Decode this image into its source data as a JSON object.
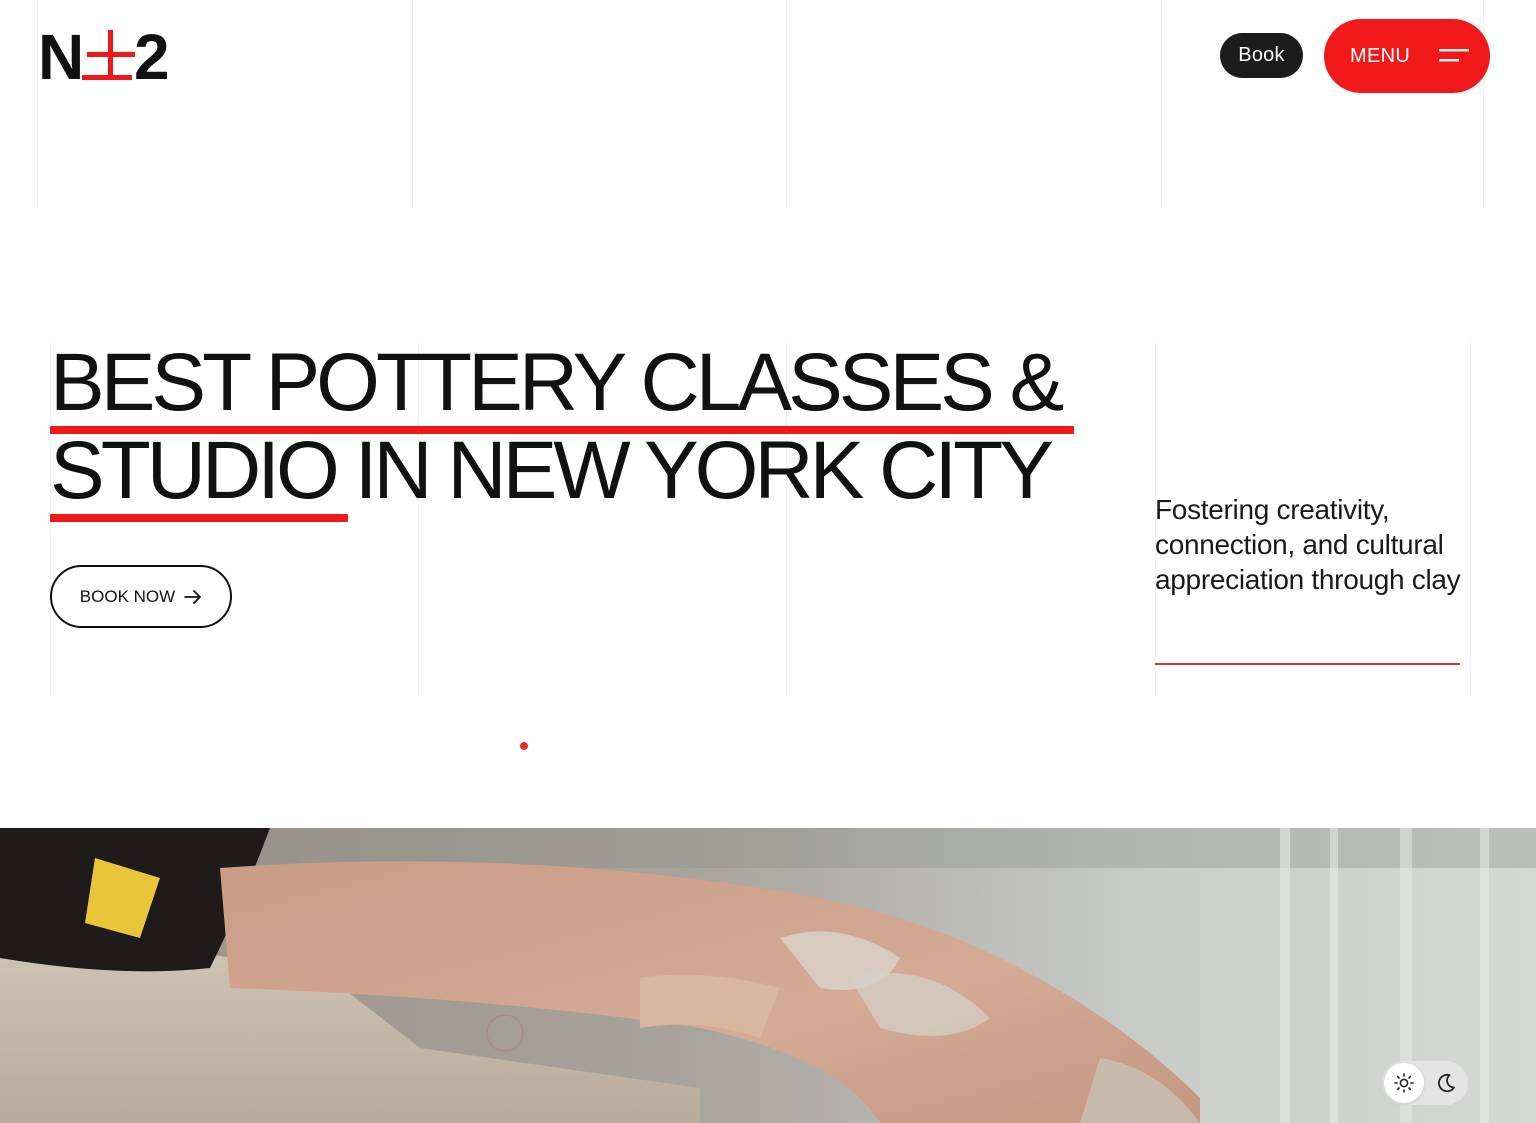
{
  "header": {
    "logo": "N±2",
    "book_label": "Book",
    "menu_label": "MENU"
  },
  "hero": {
    "heading_line1": "BEST POTTERY CLASSES &",
    "heading_line2": "STUDIO IN NEW YORK CITY",
    "cta_label": "BOOK NOW",
    "tagline": "Fostering creativity, connection, and cultural appreciation through clay"
  },
  "theme": {
    "light_icon": "sun-icon",
    "dark_icon": "moon-icon"
  },
  "colors": {
    "accent": "#f01818",
    "text": "#111111",
    "background": "#ffffff"
  }
}
